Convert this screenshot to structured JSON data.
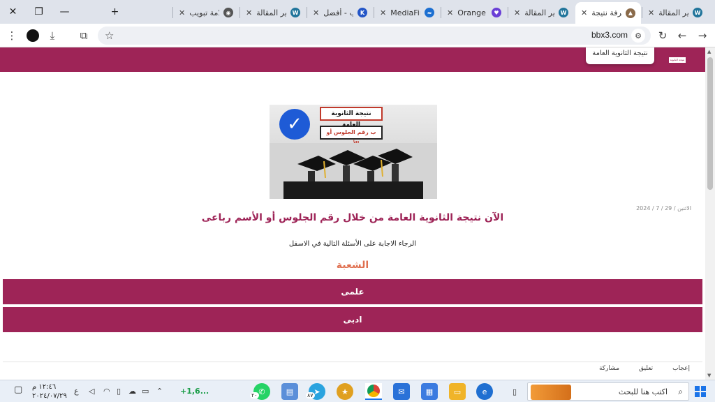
{
  "browser": {
    "tabs": [
      {
        "title": "تحرير المقالة",
        "favicon": "wordpress-icon",
        "fav_color": "#21759b",
        "fav_glyph": "W"
      },
      {
        "title": "معرفة نتيجة",
        "favicon": "site-icon",
        "fav_color": "#8a6a4a",
        "fav_glyph": "▲",
        "active": true
      },
      {
        "title": "تحرير المقالة",
        "favicon": "wordpress-icon",
        "fav_color": "#21759b",
        "fav_glyph": "W"
      },
      {
        "title": "Orange and",
        "favicon": "bookmark-icon",
        "fav_color": "#6a3fd6",
        "fav_glyph": "♥"
      },
      {
        "title": "MediaFire",
        "favicon": "mediafire-icon",
        "fav_color": "#1c6fd1",
        "fav_glyph": "≈"
      },
      {
        "title": "كاتب - أفضل",
        "favicon": "k-icon",
        "fav_color": "#2456c7",
        "fav_glyph": "K"
      },
      {
        "title": "تحرير المقالة",
        "favicon": "wordpress-icon",
        "fav_color": "#21759b",
        "fav_glyph": "W"
      },
      {
        "title": "علامة تبويب",
        "favicon": "chrome-icon",
        "fav_color": "#555555",
        "fav_glyph": "◉"
      }
    ],
    "new_tab_label": "+",
    "url": "bbx3.com"
  },
  "site": {
    "menu_item": "نتيجة الثانوية العامة",
    "logo_text": "نتيجة الثانوية العامة",
    "hero_label_1": "نتيجة الثانوية العامة",
    "hero_label_2": "ب رقم الجلوس أو الأسم",
    "post_date": "الاثنين / 29 / 7 / 2024",
    "headline": "الآن نتيجة الثانوية العامة من خلال رقم الجلوس أو الأسم رباعى",
    "instruction": "الرجاء الاجابة على الأسئلة التالية في الاسفل",
    "section_title": "الشعبة",
    "options": [
      "علمى",
      "ادبى"
    ],
    "actions": [
      "إعجاب",
      "تعليق",
      "مشاركة"
    ]
  },
  "taskbar": {
    "search_placeholder": "اكتب هنا للبحث",
    "stock_text": "+1,6...",
    "telegram_badge": "٨٧",
    "whatsapp_badge": "٢٠",
    "clock_time": "١٢:٤٦ م",
    "clock_date": "٢٠٢٤/٠٧/٢٩",
    "language": "ع"
  },
  "colors": {
    "brand": "#9e2457",
    "section": "#e07050"
  }
}
